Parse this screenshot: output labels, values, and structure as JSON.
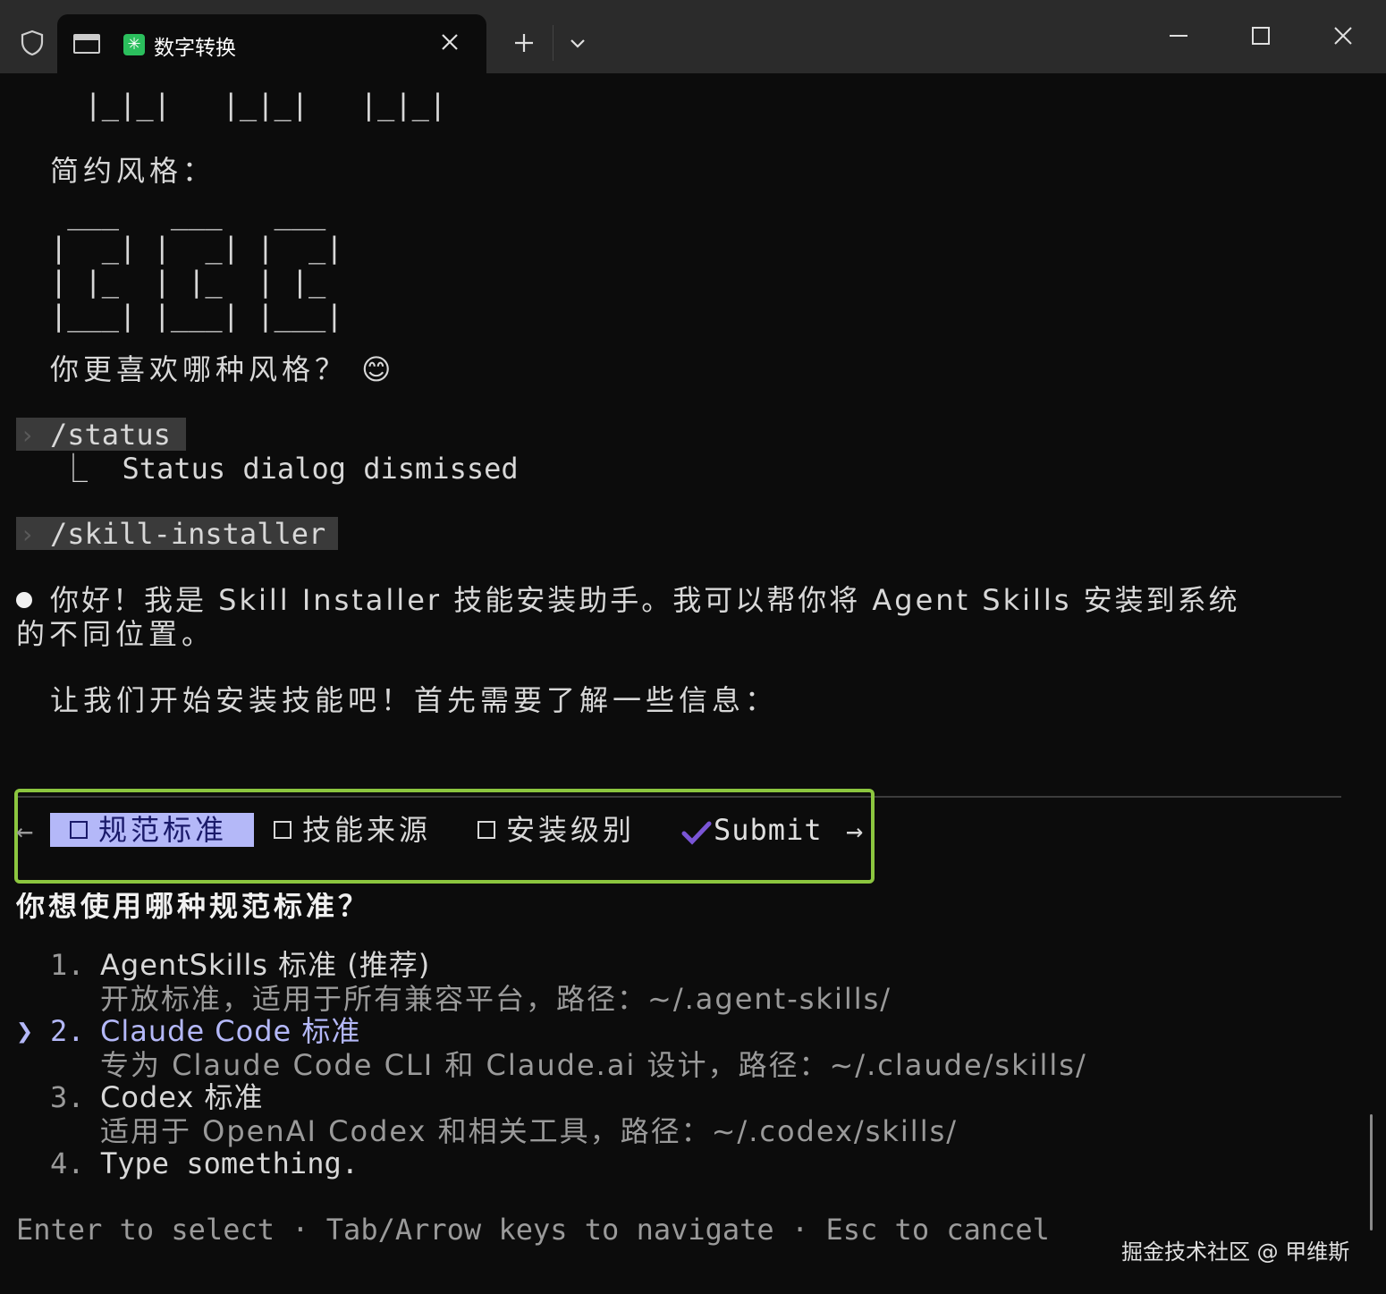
{
  "window": {
    "tab_title": "数字转换",
    "new_tab_label": "+",
    "dropdown_label": "⌄"
  },
  "terminal": {
    "ascii_top": "  |_|_|   |_|_|   |_|_|",
    "simple_style_label": "简约风格：",
    "ascii_simple": [
      " ___   ___   ___",
      "|  _| |  _| |  _|",
      "| |_  | |_  | |_",
      "|___| |___| |___|"
    ],
    "question_style": "你更喜欢哪种风格？ 😊",
    "cmd_status": "/status",
    "status_result": "⎿  Status dialog dismissed",
    "cmd_skill": "/skill-installer",
    "intro_line1": "你好！我是 Skill Installer 技能安装助手。我可以帮你将 Agent Skills 安装到系统",
    "intro_line2": "的不同位置。",
    "lets_start": "让我们开始安装技能吧！首先需要了解一些信息："
  },
  "wizard": {
    "tabs": [
      {
        "label": "规范标准",
        "active": true
      },
      {
        "label": "技能来源",
        "active": false
      },
      {
        "label": "安装级别",
        "active": false
      }
    ],
    "submit_label": "Submit",
    "prev_arrow": "←",
    "next_arrow": "→",
    "question": "你想使用哪种规范标准？",
    "options": [
      {
        "num": "1.",
        "title": "AgentSkills 标准 (推荐)",
        "desc": "开放标准，适用于所有兼容平台，路径：~/.agent-skills/"
      },
      {
        "num": "2.",
        "title": "Claude Code 标准",
        "desc": "专为 Claude Code CLI 和 Claude.ai 设计，路径：~/.claude/skills/",
        "selected": true
      },
      {
        "num": "3.",
        "title": "Codex 标准",
        "desc": "适用于 OpenAI Codex 和相关工具，路径：~/.codex/skills/"
      },
      {
        "num": "4.",
        "title": "Type something."
      }
    ],
    "cursor": "❯",
    "footer": "Enter to select · Tab/Arrow keys to navigate · Esc to cancel"
  },
  "watermark": "掘金技术社区 @ 甲维斯",
  "colors": {
    "accent": "#b4b8f8",
    "highlight_box": "#8cc63f",
    "submit_check": "#7a55d6"
  }
}
